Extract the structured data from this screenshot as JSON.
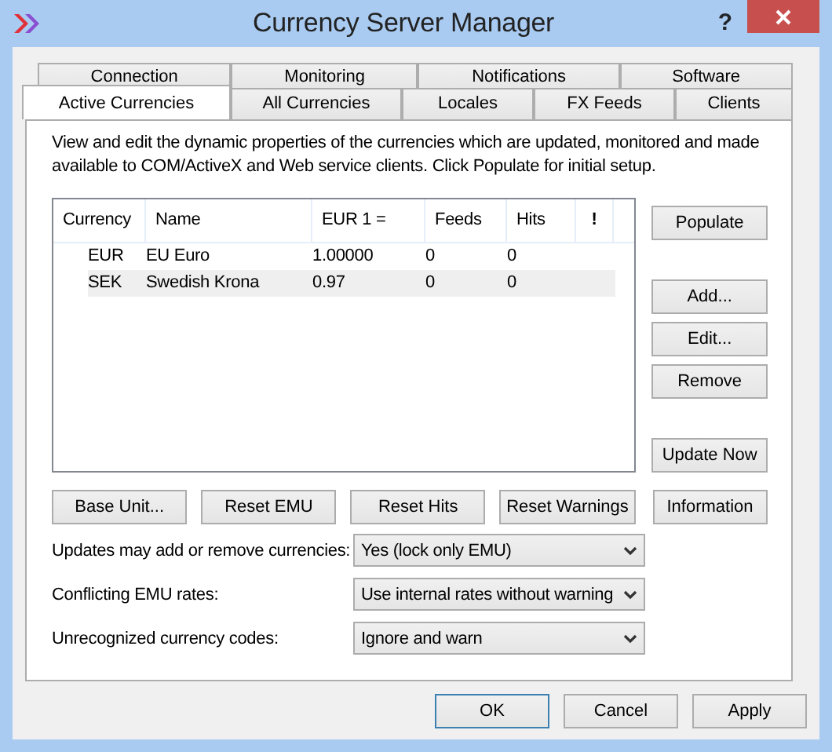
{
  "window": {
    "title": "Currency Server Manager",
    "help": "?"
  },
  "tab_rows": [
    {
      "tabs": [
        {
          "label": "Connection",
          "selected": false
        },
        {
          "label": "Monitoring",
          "selected": false
        },
        {
          "label": "Notifications",
          "selected": false
        },
        {
          "label": "Software",
          "selected": false
        }
      ]
    },
    {
      "tabs": [
        {
          "label": "Active Currencies",
          "selected": true
        },
        {
          "label": "All Currencies",
          "selected": false
        },
        {
          "label": "Locales",
          "selected": false
        },
        {
          "label": "FX Feeds",
          "selected": false
        },
        {
          "label": "Clients",
          "selected": false
        }
      ]
    }
  ],
  "description": "View and edit the dynamic properties of the currencies which are updated, monitored and made available to COM/ActiveX and Web service clients. Click Populate for initial setup.",
  "table": {
    "columns": [
      "Currency",
      "Name",
      "EUR 1 =",
      "Feeds",
      "Hits",
      "!"
    ],
    "rows": [
      {
        "cells": [
          "EUR",
          "EU Euro",
          "1.00000",
          "0",
          "0"
        ],
        "selected": false
      },
      {
        "cells": [
          "SEK",
          "Swedish Krona",
          "0.97",
          "0",
          "0"
        ],
        "selected": true
      }
    ]
  },
  "side_buttons": [
    {
      "label": "Populate"
    },
    {
      "label": "Add..."
    },
    {
      "label": "Edit..."
    },
    {
      "label": "Remove"
    },
    {
      "label": "Update Now"
    }
  ],
  "bottom_buttons": [
    "Base Unit...",
    "Reset EMU",
    "Reset Hits",
    "Reset Warnings",
    "Information"
  ],
  "settings": [
    {
      "label": "Updates may add or remove currencies:",
      "value": "Yes (lock only EMU)"
    },
    {
      "label": "Conflicting EMU rates:",
      "value": "Use internal rates without warning"
    },
    {
      "label": "Unrecognized currency codes:",
      "value": "Ignore and warn"
    }
  ],
  "dialog_buttons": [
    {
      "label": "OK",
      "default": true
    },
    {
      "label": "Cancel",
      "default": false
    },
    {
      "label": "Apply",
      "default": false
    }
  ]
}
